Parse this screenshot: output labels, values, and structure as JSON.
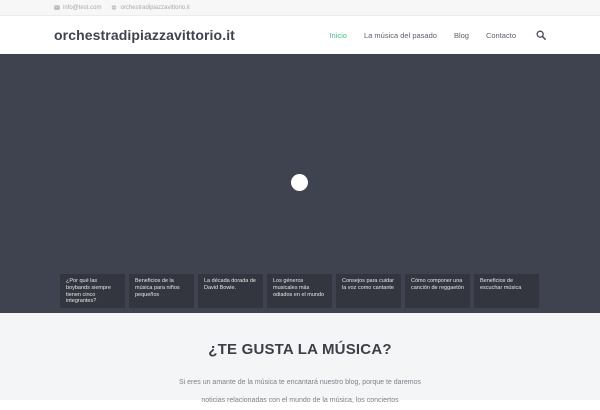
{
  "topbar": {
    "email": "info@test.com",
    "site": "orchestradipiazzavittorio.it",
    "email_icon": "envelope-icon",
    "site_icon": "globe-icon"
  },
  "header": {
    "logo": "orchestradipiazzavittorio.it",
    "nav": [
      {
        "label": "Inicio",
        "active": true
      },
      {
        "label": "La música del pasado",
        "active": false
      },
      {
        "label": "Blog",
        "active": false
      },
      {
        "label": "Contacto",
        "active": false
      }
    ],
    "search_icon": "search-icon"
  },
  "hero": {
    "background_color": "#3f4350",
    "cards": [
      {
        "title": "¿Por qué las boybands siempre tienen cinco integrantes?"
      },
      {
        "title": "Beneficios de la música para niños pequeños"
      },
      {
        "title": "La década dorada de David Bowie."
      },
      {
        "title": "Los géneros musicales más odiados en el mundo"
      },
      {
        "title": "Consejos para cuidar la voz como cantante"
      },
      {
        "title": "Cómo componer una canción de reggaetón"
      },
      {
        "title": "Beneficios de escuchar música"
      }
    ]
  },
  "intro": {
    "title": "¿TE GUSTA LA MÚSICA?",
    "text": "Si eres un amante de la música te encantará nuestro blog, porque te daremos noticias relacionadas con el mundo de la música, los conciertos"
  },
  "colors": {
    "accent": "#4cc08a",
    "hero_bg": "#3f4350",
    "card_bg": "#33363f"
  }
}
